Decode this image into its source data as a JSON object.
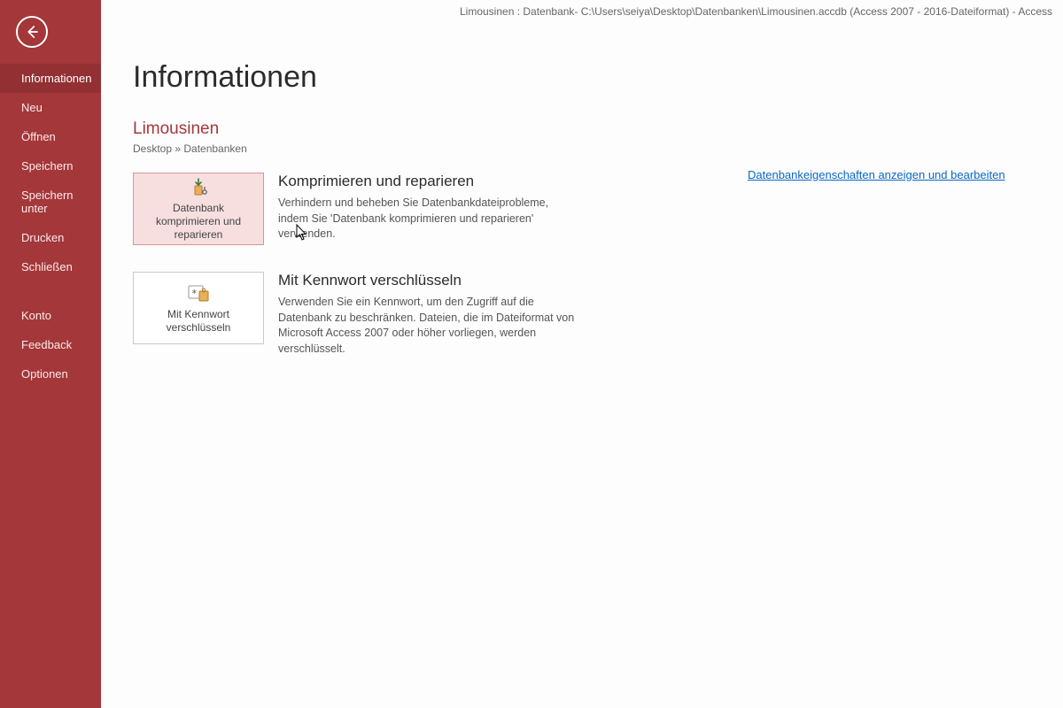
{
  "titlebar": "Limousinen : Datenbank- C:\\Users\\seiya\\Desktop\\Datenbanken\\Limousinen.accdb (Access 2007 - 2016-Dateiformat)  -  Access",
  "sidebar": {
    "items": [
      {
        "label": "Informationen",
        "selected": true
      },
      {
        "label": "Neu"
      },
      {
        "label": "Öffnen"
      },
      {
        "label": "Speichern"
      },
      {
        "label": "Speichern unter"
      },
      {
        "label": "Drucken"
      },
      {
        "label": "Schließen"
      }
    ],
    "bottom": [
      {
        "label": "Konto"
      },
      {
        "label": "Feedback"
      },
      {
        "label": "Optionen"
      }
    ]
  },
  "page": {
    "title": "Informationen",
    "db_name": "Limousinen",
    "breadcrumb": "Desktop » Datenbanken",
    "side_link": "Datenbankeigenschaften anzeigen und bearbeiten"
  },
  "sections": [
    {
      "tile_label": "Datenbank komprimieren und reparieren",
      "highlight": true,
      "title": "Komprimieren und reparieren",
      "body": "Verhindern und beheben Sie Datenbankdateiprobleme, indem Sie 'Datenbank komprimieren und reparieren' verwenden.",
      "icon": "compact-repair-icon"
    },
    {
      "tile_label": "Mit Kennwort verschlüsseln",
      "highlight": false,
      "title": "Mit Kennwort verschlüsseln",
      "body": "Verwenden Sie ein Kennwort, um den Zugriff auf die Datenbank zu beschränken. Dateien, die im Dateiformat von Microsoft Access 2007 oder höher vorliegen, werden verschlüsselt.",
      "icon": "encrypt-password-icon"
    }
  ]
}
